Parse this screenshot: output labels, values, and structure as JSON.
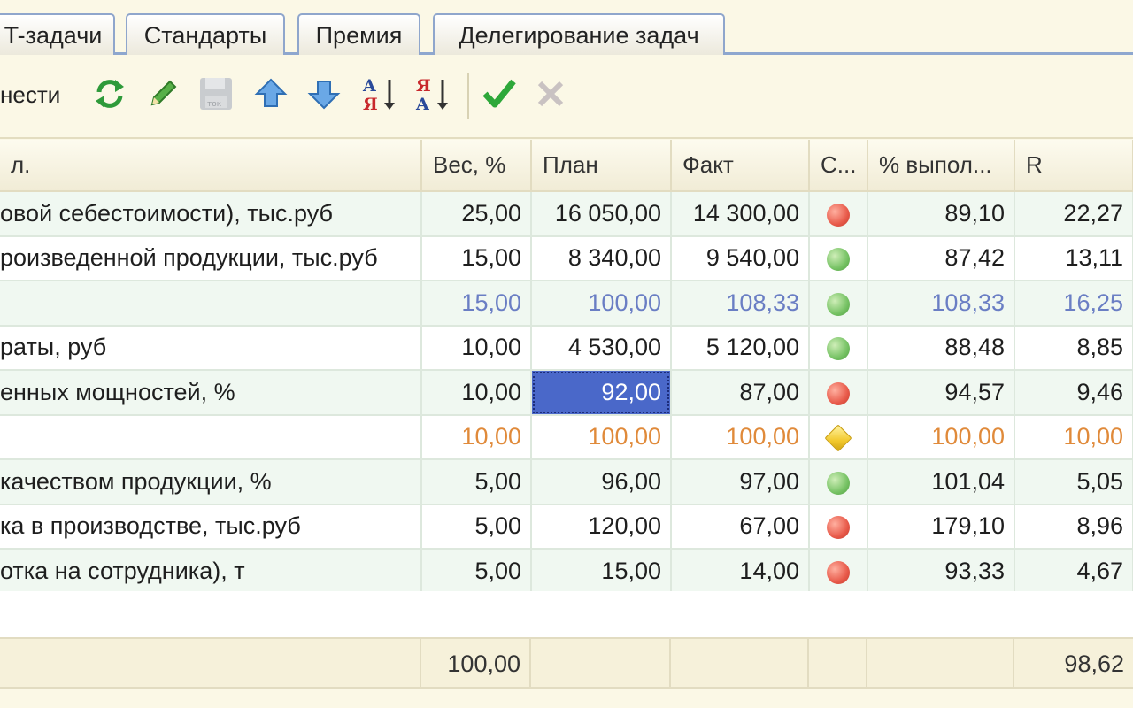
{
  "tabs": [
    {
      "label": "T-задачи"
    },
    {
      "label": "Стандарты"
    },
    {
      "label": "Премия"
    },
    {
      "label": "Делегирование задач"
    }
  ],
  "toolbar": {
    "label": "нести",
    "buttons": [
      {
        "name": "refresh",
        "icon": "refresh-icon"
      },
      {
        "name": "edit",
        "icon": "pencil-icon"
      },
      {
        "name": "save",
        "icon": "save-disabled-icon"
      },
      {
        "name": "move-up",
        "icon": "arrow-up-icon"
      },
      {
        "name": "move-down",
        "icon": "arrow-down-icon"
      },
      {
        "name": "sort-asc",
        "icon": "sort-asc-icon"
      },
      {
        "name": "sort-desc",
        "icon": "sort-desc-icon"
      },
      {
        "name": "apply",
        "icon": "checkmark-icon"
      },
      {
        "name": "cancel",
        "icon": "cross-icon"
      }
    ]
  },
  "table": {
    "columns": [
      "л.",
      "Вес, %",
      "План",
      "Факт",
      "С...",
      "% выпол...",
      "R"
    ],
    "rows": [
      {
        "name": "овой себестоимости), тыс.руб",
        "weight": "25,00",
        "plan": "16 050,00",
        "fact": "14 300,00",
        "status": "red",
        "pct": "89,10",
        "r": "22,27"
      },
      {
        "name": "роизведенной продукции, тыс.руб",
        "weight": "15,00",
        "plan": "8 340,00",
        "fact": "9 540,00",
        "status": "green",
        "pct": "87,42",
        "r": "13,11"
      },
      {
        "name": "",
        "weight": "15,00",
        "plan": "100,00",
        "fact": "108,33",
        "status": "green",
        "pct": "108,33",
        "r": "16,25",
        "style": "blue"
      },
      {
        "name": "раты, руб",
        "weight": "10,00",
        "plan": "4 530,00",
        "fact": "5 120,00",
        "status": "green",
        "pct": "88,48",
        "r": "8,85"
      },
      {
        "name": "енных мощностей, %",
        "weight": "10,00",
        "plan": "92,00",
        "fact": "87,00",
        "status": "red",
        "pct": "94,57",
        "r": "9,46",
        "selected": "plan"
      },
      {
        "name": "",
        "weight": "10,00",
        "plan": "100,00",
        "fact": "100,00",
        "status": "yellow",
        "pct": "100,00",
        "r": "10,00",
        "style": "orange"
      },
      {
        "name": "качеством продукции, %",
        "weight": "5,00",
        "plan": "96,00",
        "fact": "97,00",
        "status": "green",
        "pct": "101,04",
        "r": "5,05"
      },
      {
        "name": "ка в производстве, тыс.руб",
        "weight": "5,00",
        "plan": "120,00",
        "fact": "67,00",
        "status": "red",
        "pct": "179,10",
        "r": "8,96"
      },
      {
        "name": "отка на сотрудника), т",
        "weight": "5,00",
        "plan": "15,00",
        "fact": "14,00",
        "status": "red",
        "pct": "93,33",
        "r": "4,67"
      }
    ]
  },
  "footer": {
    "weight_total": "100,00",
    "r_total": "98,62"
  },
  "colors": {
    "status_red": "#e85a4a",
    "status_green": "#76c264",
    "status_yellow": "#f2c92e",
    "selection": "#4a68c9",
    "blue_row_text": "#6a7ec4",
    "orange_row_text": "#e08a3a"
  }
}
